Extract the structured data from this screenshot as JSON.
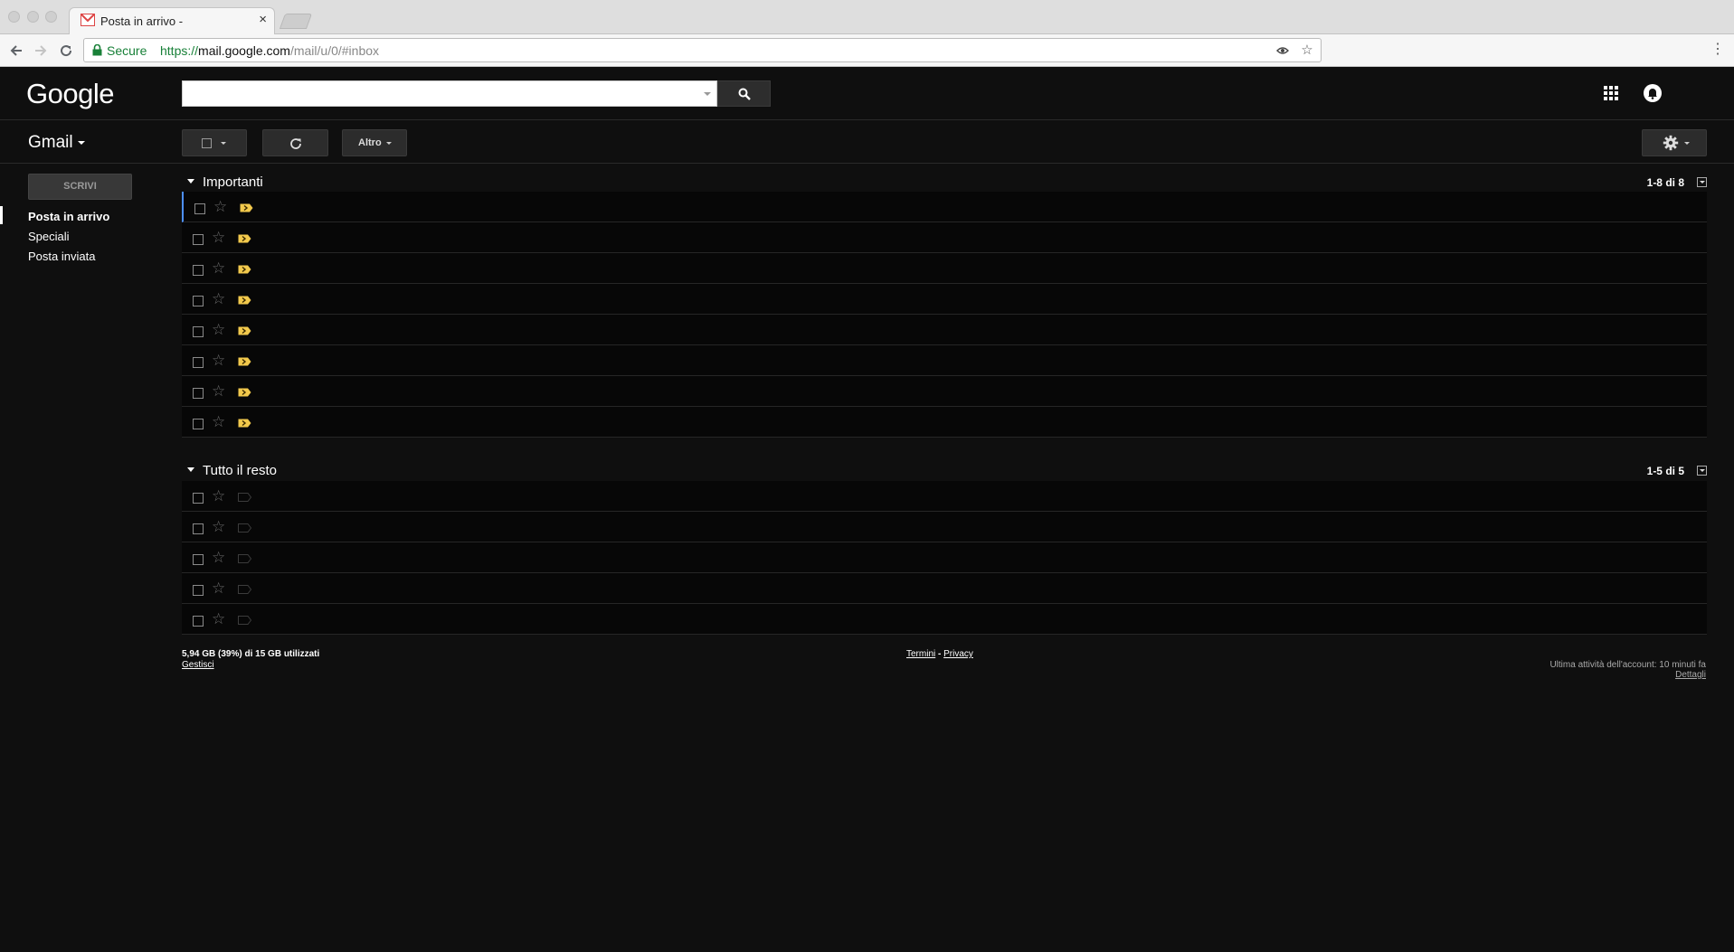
{
  "browser": {
    "tab_title": "Posta in arrivo -",
    "tab_close": "×",
    "secure_label": "Secure",
    "url_protocol": "https://",
    "url_host": "mail.google.com",
    "url_path": "/mail/u/0/#inbox",
    "menu_dots": "⋮"
  },
  "header": {
    "logo": "Google",
    "search_value": ""
  },
  "subheader": {
    "app_label": "Gmail",
    "more_label": "Altro"
  },
  "sidebar": {
    "compose_label": "SCRIVI",
    "items": [
      {
        "label": "Posta in arrivo",
        "active": true
      },
      {
        "label": "Speciali",
        "active": false
      },
      {
        "label": "Posta inviata",
        "active": false
      }
    ]
  },
  "sections": [
    {
      "title": "Importanti",
      "count": "1-8 di 8",
      "rows": 8,
      "important": true
    },
    {
      "title": "Tutto il resto",
      "count": "1-5 di 5",
      "rows": 5,
      "important": false
    }
  ],
  "footer": {
    "usage": "5,94 GB (39%) di 15 GB utilizzati",
    "manage": "Gestisci",
    "terms": "Termini",
    "separator": " - ",
    "privacy": "Privacy",
    "last_activity": "Ultima attività dell'account: 10 minuti fa",
    "details": "Dettagli"
  },
  "colors": {
    "background": "#0f0f0f",
    "row_background": "#070707",
    "important_tag": "#f2c94c",
    "selected_row_marker": "#4d90fe"
  }
}
